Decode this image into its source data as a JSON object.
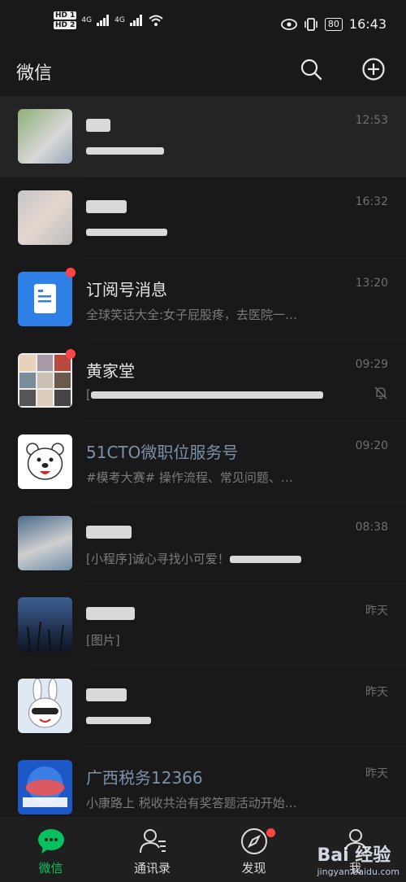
{
  "status_bar": {
    "net1": "4G",
    "net2": "4G",
    "hd1": "HD 1",
    "hd2": "HD 2",
    "battery": "80",
    "time": "16:43"
  },
  "app_bar": {
    "title": "微信",
    "search_icon": "search-icon",
    "add_icon": "plus-circle-icon"
  },
  "chats": [
    {
      "name": "",
      "preview": "",
      "time": "12:53"
    },
    {
      "name": "",
      "preview": "",
      "time": "16:32"
    },
    {
      "name": "订阅号消息",
      "preview": "全球笑话大全:女子屁股疼，去医院一…",
      "time": "13:20"
    },
    {
      "name": "黄家堂",
      "preview": "[",
      "time": "09:29"
    },
    {
      "name": "51CTO微职位服务号",
      "preview": "#模考大赛# 操作流程、常见问题、…",
      "time": "09:20"
    },
    {
      "name": "",
      "preview": "[小程序]诚心寻找小可爱！",
      "time": "08:38"
    },
    {
      "name": "",
      "preview": "[图片]",
      "time": "昨天"
    },
    {
      "name": "",
      "preview": "",
      "time": "昨天"
    },
    {
      "name": "广西税务12366",
      "preview": "小康路上 税收共治有奖答题活动开始…",
      "time": "昨天"
    }
  ],
  "tabs": [
    {
      "label": "微信",
      "icon": "chat-bubble-icon"
    },
    {
      "label": "通讯录",
      "icon": "contacts-icon"
    },
    {
      "label": "发现",
      "icon": "compass-icon"
    },
    {
      "label": "我",
      "icon": "person-icon"
    }
  ],
  "watermark": {
    "brand": "Bai 经验",
    "url": "jingyan.baidu.com"
  },
  "colors": {
    "background": "#191919",
    "accent": "#07c160",
    "badge": "#ff4444",
    "official_name": "#7d90a9"
  }
}
